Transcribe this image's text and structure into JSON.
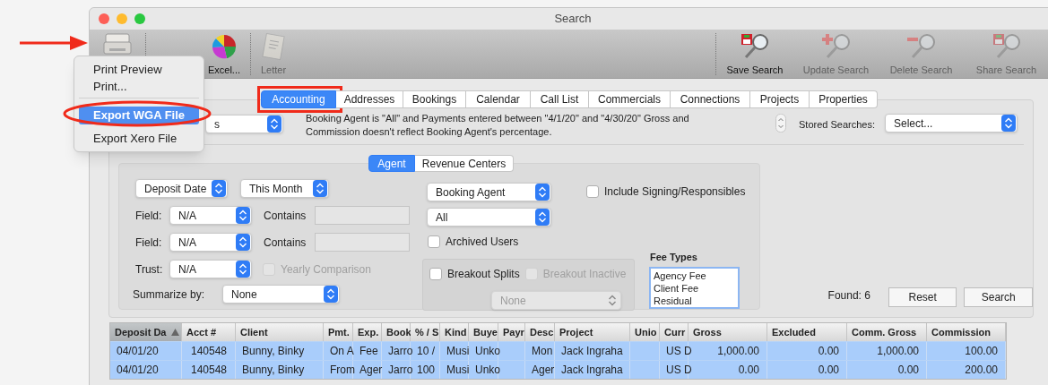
{
  "window": {
    "title": "Search"
  },
  "toolbar": {
    "left": [
      {
        "kind": "printer",
        "disabled": false
      },
      {
        "kind": "chart",
        "label": "Excel...",
        "disabled": false
      },
      {
        "kind": "letter",
        "label": "Letter",
        "disabled": true
      }
    ],
    "right": [
      {
        "kind": "save",
        "label": "Save Search",
        "disabled": false
      },
      {
        "kind": "update",
        "label": "Update Search",
        "disabled": true
      },
      {
        "kind": "delete",
        "label": "Delete Search",
        "disabled": true
      },
      {
        "kind": "share",
        "label": "Share Search",
        "disabled": true
      }
    ]
  },
  "menu": {
    "items": [
      {
        "kind": "item",
        "label": "Print Preview",
        "selected": false
      },
      {
        "kind": "item",
        "label": "Print...",
        "selected": false
      },
      {
        "kind": "separator"
      },
      {
        "kind": "item",
        "label": "Export WGA File",
        "selected": true
      },
      {
        "kind": "item",
        "label": "Export Xero File",
        "selected": false
      }
    ]
  },
  "tabs": [
    {
      "label": "Accounting",
      "selected": true
    },
    {
      "label": "Addresses",
      "selected": false
    },
    {
      "label": "Bookings",
      "selected": false
    },
    {
      "label": "Calendar",
      "selected": false
    },
    {
      "label": "Call List",
      "selected": false
    },
    {
      "label": "Commercials",
      "selected": false
    },
    {
      "label": "Connections",
      "selected": false
    },
    {
      "label": "Projects",
      "selected": false
    },
    {
      "label": "Properties",
      "selected": false
    }
  ],
  "query": {
    "dropdown_value": "s",
    "description": "Booking Agent is \"All\" and Payments entered between \"4/1/20\" and \"4/30/20\" Gross and Commission doesn't reflect Booking Agent's percentage.",
    "stored_searches_label": "Stored Searches:",
    "stored_searches_value": "Select..."
  },
  "subtabs": [
    {
      "label": "Agent",
      "selected": true
    },
    {
      "label": "Revenue Centers",
      "selected": false
    }
  ],
  "criteria": {
    "date_field": "Deposit Date",
    "date_range": "This Month",
    "fields": [
      {
        "label": "Field:",
        "value": "N/A",
        "contains_label": "Contains"
      },
      {
        "label": "Field:",
        "value": "N/A",
        "contains_label": "Contains"
      }
    ],
    "trust": {
      "label": "Trust:",
      "value": "N/A"
    },
    "yearly_comparison": {
      "label": "Yearly Comparison",
      "checked": false,
      "disabled": true
    },
    "summarize": {
      "label": "Summarize by:",
      "value": "None"
    },
    "agent_type": "Booking Agent",
    "agent": "All",
    "archived_users": {
      "label": "Archived Users",
      "checked": false,
      "disabled": false
    },
    "breakout_splits": {
      "label": "Breakout Splits",
      "checked": false,
      "disabled": false
    },
    "breakout_inactive": {
      "label": "Breakout Inactive",
      "checked": false,
      "disabled": true
    },
    "split_select": {
      "value": "None",
      "disabled": true
    },
    "include_signing": {
      "label": "Include Signing/Responsibles",
      "checked": false,
      "disabled": false
    },
    "fee_types": {
      "label": "Fee Types",
      "items": [
        "Agency Fee",
        "Client Fee",
        "Residual"
      ]
    }
  },
  "results": {
    "found": "Found: 6",
    "buttons": [
      "Reset",
      "Search"
    ]
  },
  "table": {
    "columns": [
      {
        "label": "Deposit Da",
        "sorted": true
      },
      {
        "label": "Acct #",
        "sorted": false
      },
      {
        "label": "Client",
        "sorted": false
      },
      {
        "label": "Pmt.",
        "sorted": false
      },
      {
        "label": "Exp.",
        "sorted": false
      },
      {
        "label": "Book",
        "sorted": false
      },
      {
        "label": "% / S",
        "sorted": false
      },
      {
        "label": "Kind",
        "sorted": false
      },
      {
        "label": "Buye",
        "sorted": false
      },
      {
        "label": "Payr",
        "sorted": false
      },
      {
        "label": "Desc",
        "sorted": false
      },
      {
        "label": "Project",
        "sorted": false
      },
      {
        "label": "Unio",
        "sorted": false
      },
      {
        "label": "Curr",
        "sorted": false
      },
      {
        "label": "Gross",
        "sorted": false
      },
      {
        "label": "Excluded",
        "sorted": false
      },
      {
        "label": "Comm. Gross",
        "sorted": false
      },
      {
        "label": "Commission",
        "sorted": false
      }
    ],
    "rows": [
      {
        "selected": true,
        "cells": [
          "04/01/20",
          "140548",
          "Bunny, Binky",
          "On A",
          "Fee",
          "Jarro",
          "10 /",
          "Musi",
          "Unko",
          null,
          "Mon",
          "Jack Ingraha",
          null,
          "US D",
          "1,000.00",
          "0.00",
          "1,000.00",
          "100.00"
        ]
      },
      {
        "selected": true,
        "cells": [
          "04/01/20",
          "140548",
          "Bunny, Binky",
          "From",
          "Ager",
          "Jarro",
          "100",
          "Musi",
          "Unko",
          null,
          "Ager",
          "Jack Ingraha",
          null,
          "US D",
          "0.00",
          "0.00",
          "0.00",
          "200.00"
        ]
      }
    ]
  }
}
